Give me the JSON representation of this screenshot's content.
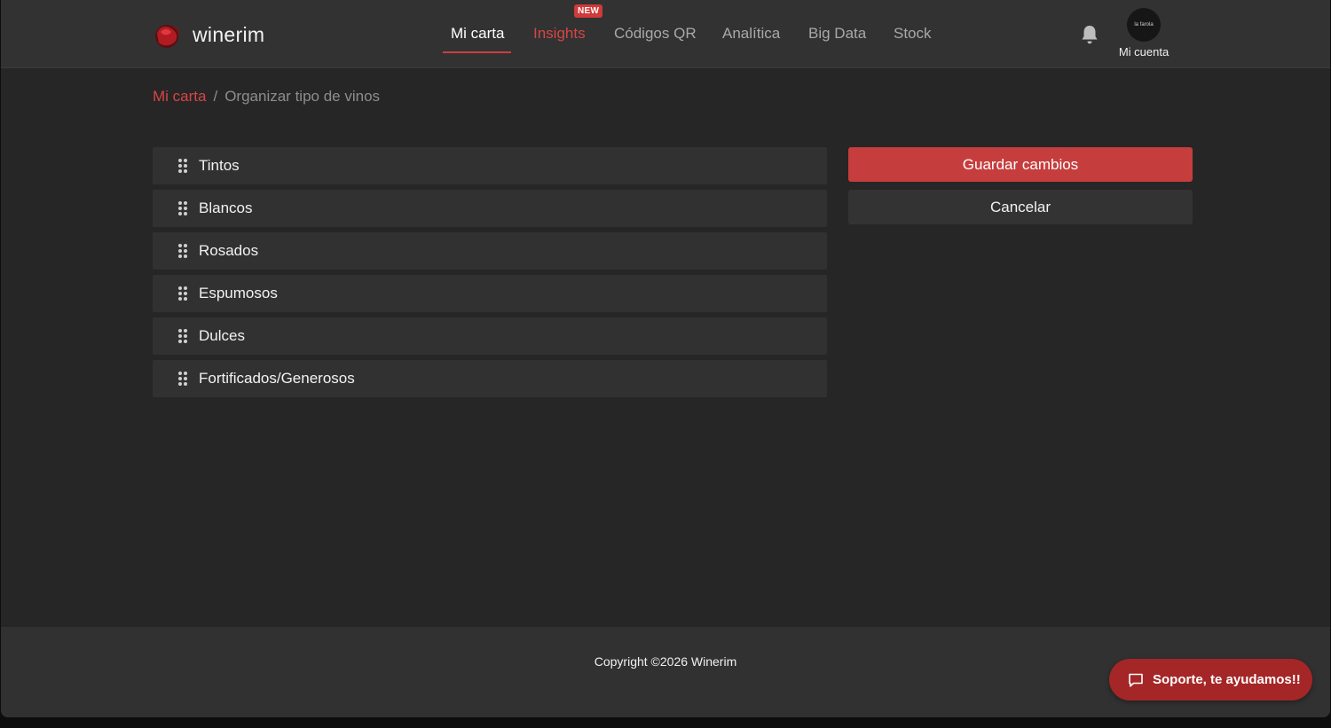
{
  "brand": {
    "name": "winerim",
    "accent_color": "#c63d3d"
  },
  "nav": {
    "items": [
      {
        "label": "Mi carta",
        "state": "active"
      },
      {
        "label": "Insights",
        "state": "accent",
        "badge": "NEW"
      },
      {
        "label": "Códigos QR",
        "state": "normal"
      },
      {
        "label": "Analítica",
        "state": "normal"
      },
      {
        "label": "Big Data",
        "state": "normal"
      },
      {
        "label": "Stock",
        "state": "normal"
      }
    ]
  },
  "header": {
    "notifications_icon": "bell-icon",
    "account_label": "Mi cuenta",
    "avatar_text": "la farola"
  },
  "breadcrumb": {
    "link": "Mi carta",
    "separator": "/",
    "current": "Organizar tipo de vinos"
  },
  "wine_types": [
    {
      "label": "Tintos"
    },
    {
      "label": "Blancos"
    },
    {
      "label": "Rosados"
    },
    {
      "label": "Espumosos"
    },
    {
      "label": "Dulces"
    },
    {
      "label": "Fortificados/Generosos"
    }
  ],
  "actions": {
    "save_label": "Guardar cambios",
    "cancel_label": "Cancelar"
  },
  "footer": {
    "copyright": "Copyright ©2026 Winerim"
  },
  "support": {
    "label": "Soporte, te ayudamos!!",
    "icon": "chat-bubble-icon"
  }
}
